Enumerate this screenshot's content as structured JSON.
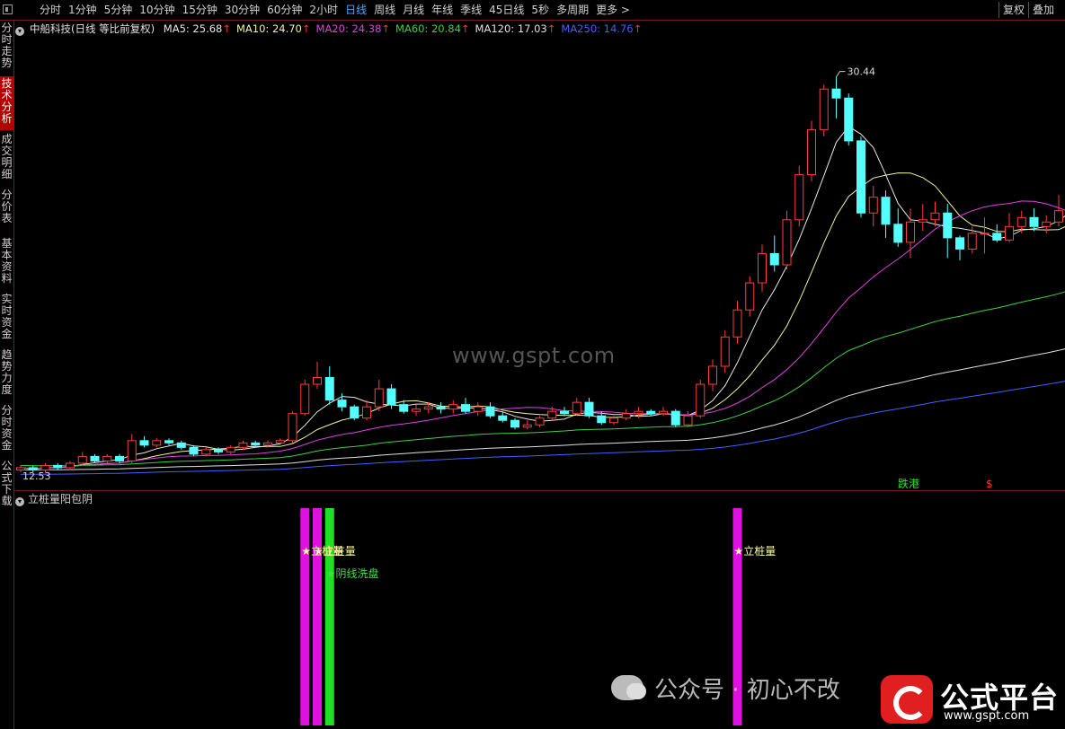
{
  "toolbar": {
    "periods": [
      "分时",
      "1分钟",
      "5分钟",
      "10分钟",
      "15分钟",
      "30分钟",
      "60分钟",
      "2小时",
      "日线",
      "周线",
      "月线",
      "年线",
      "季线",
      "45日线",
      "5秒",
      "多周期",
      "更多 >"
    ],
    "active_period": "日线",
    "right_buttons": [
      "复权",
      "叠加"
    ]
  },
  "side_tabs": [
    {
      "label": "分时走势",
      "active": false
    },
    {
      "label": "技术分析",
      "active": true
    },
    {
      "label": "成交明细",
      "active": false
    },
    {
      "label": "分价表",
      "active": false
    },
    {
      "label": "基本资料",
      "active": false
    },
    {
      "label": "实时资金",
      "active": false
    },
    {
      "label": "趋势力度",
      "active": false
    },
    {
      "label": "分时资金",
      "active": false
    },
    {
      "label": "公式下载",
      "active": false
    }
  ],
  "info": {
    "title": "中船科技(日线 等比前复权)",
    "ma": [
      {
        "label": "MA5: 25.68",
        "color": "#e8e8e8"
      },
      {
        "label": "MA10: 24.70",
        "color": "#f2f2a0"
      },
      {
        "label": "MA20: 24.38",
        "color": "#e040e0"
      },
      {
        "label": "MA60: 20.84",
        "color": "#40d040"
      },
      {
        "label": "MA120: 17.03",
        "color": "#e0e0e0"
      },
      {
        "label": "MA250: 14.76",
        "color": "#4060ff"
      }
    ],
    "arrow": "↑"
  },
  "chart_data": {
    "type": "candlestick",
    "ylim": [
      12.5,
      31.5
    ],
    "high_label": "30.44",
    "low_label": "12.53",
    "candles": [
      [
        13.0,
        13.1,
        12.9,
        13.2
      ],
      [
        13.1,
        13.0,
        12.9,
        13.2
      ],
      [
        13.0,
        13.2,
        12.9,
        13.3
      ],
      [
        13.2,
        13.1,
        13.0,
        13.3
      ],
      [
        13.1,
        13.3,
        13.0,
        13.4
      ],
      [
        13.3,
        13.6,
        13.2,
        13.8
      ],
      [
        13.6,
        13.4,
        13.3,
        13.7
      ],
      [
        13.4,
        13.6,
        13.3,
        13.7
      ],
      [
        13.6,
        13.4,
        13.3,
        13.7
      ],
      [
        13.4,
        14.3,
        13.3,
        14.6
      ],
      [
        14.3,
        14.1,
        14.0,
        14.5
      ],
      [
        14.1,
        14.3,
        14.0,
        14.4
      ],
      [
        14.3,
        14.2,
        14.1,
        14.4
      ],
      [
        14.2,
        14.0,
        13.9,
        14.3
      ],
      [
        14.0,
        13.7,
        13.6,
        14.1
      ],
      [
        13.7,
        13.9,
        13.6,
        14.0
      ],
      [
        13.9,
        13.8,
        13.7,
        14.0
      ],
      [
        13.8,
        14.0,
        13.7,
        14.1
      ],
      [
        14.0,
        14.2,
        13.9,
        14.3
      ],
      [
        14.2,
        14.1,
        14.0,
        14.3
      ],
      [
        14.1,
        14.2,
        14.0,
        14.3
      ],
      [
        14.2,
        14.3,
        14.1,
        14.4
      ],
      [
        14.3,
        15.5,
        14.2,
        15.6
      ],
      [
        15.5,
        16.8,
        15.4,
        17.0
      ],
      [
        16.8,
        17.1,
        16.6,
        17.8
      ],
      [
        17.1,
        16.1,
        15.9,
        17.6
      ],
      [
        16.1,
        15.8,
        15.6,
        16.4
      ],
      [
        15.8,
        15.3,
        15.2,
        15.9
      ],
      [
        15.3,
        15.8,
        15.2,
        16.1
      ],
      [
        15.8,
        16.6,
        15.6,
        17.0
      ],
      [
        16.6,
        15.9,
        15.7,
        16.8
      ],
      [
        15.9,
        15.6,
        15.5,
        16.1
      ],
      [
        15.6,
        15.7,
        15.4,
        15.9
      ],
      [
        15.7,
        15.8,
        15.5,
        16.0
      ],
      [
        15.8,
        15.7,
        15.5,
        16.0
      ],
      [
        15.7,
        15.9,
        15.5,
        16.1
      ],
      [
        15.9,
        15.6,
        15.5,
        16.2
      ],
      [
        15.6,
        15.8,
        15.4,
        16.0
      ],
      [
        15.8,
        15.4,
        15.3,
        16.0
      ],
      [
        15.4,
        15.2,
        15.1,
        15.6
      ],
      [
        15.2,
        14.9,
        14.8,
        15.3
      ],
      [
        14.9,
        15.0,
        14.8,
        15.2
      ],
      [
        15.0,
        15.3,
        14.9,
        15.4
      ],
      [
        15.3,
        15.6,
        15.2,
        15.8
      ],
      [
        15.6,
        15.5,
        15.4,
        15.8
      ],
      [
        15.5,
        16.0,
        15.4,
        16.2
      ],
      [
        16.0,
        15.4,
        15.3,
        16.2
      ],
      [
        15.4,
        15.1,
        15.0,
        15.6
      ],
      [
        15.1,
        15.3,
        15.0,
        15.4
      ],
      [
        15.3,
        15.5,
        15.2,
        15.7
      ],
      [
        15.5,
        15.6,
        15.3,
        15.8
      ],
      [
        15.6,
        15.5,
        15.4,
        15.7
      ],
      [
        15.5,
        15.6,
        15.4,
        15.8
      ],
      [
        15.6,
        15.0,
        14.9,
        15.7
      ],
      [
        15.0,
        15.4,
        14.9,
        15.6
      ],
      [
        15.4,
        16.8,
        15.3,
        17.0
      ],
      [
        16.8,
        17.6,
        16.5,
        17.9
      ],
      [
        17.6,
        18.9,
        17.3,
        19.2
      ],
      [
        18.9,
        20.1,
        18.6,
        20.5
      ],
      [
        20.1,
        21.3,
        19.8,
        21.6
      ],
      [
        21.3,
        22.6,
        20.9,
        23.0
      ],
      [
        22.6,
        22.1,
        21.8,
        23.4
      ],
      [
        22.1,
        24.1,
        21.9,
        24.5
      ],
      [
        24.1,
        26.1,
        23.8,
        26.5
      ],
      [
        26.1,
        28.1,
        25.8,
        28.5
      ],
      [
        28.1,
        29.9,
        27.8,
        30.1
      ],
      [
        29.9,
        29.5,
        28.6,
        30.44
      ],
      [
        29.5,
        27.6,
        27.4,
        29.7
      ],
      [
        27.6,
        24.4,
        24.2,
        27.8
      ],
      [
        24.4,
        25.1,
        23.8,
        25.6
      ],
      [
        25.1,
        23.9,
        23.3,
        25.4
      ],
      [
        23.9,
        23.1,
        22.9,
        24.6
      ],
      [
        23.1,
        24.0,
        22.4,
        24.6
      ],
      [
        24.0,
        24.1,
        23.6,
        24.8
      ],
      [
        24.1,
        24.4,
        23.8,
        24.9
      ],
      [
        24.4,
        23.3,
        22.4,
        24.8
      ],
      [
        23.3,
        22.8,
        22.3,
        23.4
      ],
      [
        22.8,
        23.5,
        22.6,
        23.8
      ],
      [
        23.5,
        23.5,
        22.6,
        24.2
      ],
      [
        23.5,
        23.2,
        23.1,
        23.9
      ],
      [
        23.2,
        23.8,
        23.1,
        24.4
      ],
      [
        23.8,
        24.2,
        23.5,
        24.5
      ],
      [
        24.2,
        23.8,
        23.6,
        24.6
      ],
      [
        23.8,
        24.0,
        23.5,
        24.3
      ],
      [
        24.0,
        24.5,
        23.8,
        25.2
      ],
      [
        24.5,
        25.8,
        24.3,
        26.5
      ],
      [
        25.8,
        25.1,
        24.8,
        26.2
      ]
    ],
    "ma_series": [
      {
        "name": "MA5",
        "color": "#e8e8e8"
      },
      {
        "name": "MA10",
        "color": "#f2f2a0"
      },
      {
        "name": "MA20",
        "color": "#e040e0"
      },
      {
        "name": "MA60",
        "color": "#40d040"
      },
      {
        "name": "MA120",
        "color": "#e0e0e0"
      },
      {
        "name": "MA250",
        "color": "#4060ff"
      }
    ]
  },
  "chart_labels": {
    "die_gang": "跌港",
    "s_mark": "$"
  },
  "indicator": {
    "title": "立桩量阳包阴",
    "signals": [
      {
        "label": "★立桩量",
        "color": "#ffffa0"
      },
      {
        "label": "★立桩量",
        "color": "#ffffa0"
      },
      {
        "label": "★阴线洗盘",
        "color": "#40e040"
      },
      {
        "label": "★立桩量",
        "color": "#ffffa0"
      }
    ],
    "bar_colors": [
      "#e010e0",
      "#e010e0",
      "#20e020",
      "#e010e0"
    ]
  },
  "watermarks": {
    "site": "www.gspt.com",
    "wechat": "公众号 · 初心不改",
    "logo_text": "公式平台",
    "logo_url": "www.gspt.com"
  }
}
